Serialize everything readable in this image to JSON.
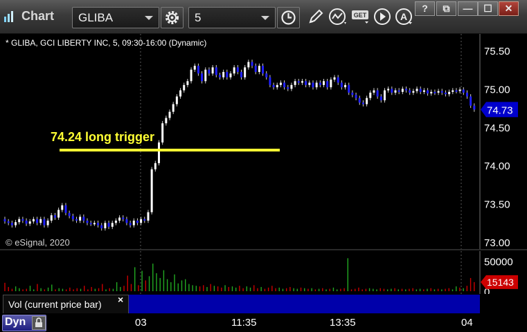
{
  "app": {
    "title": "Chart"
  },
  "toolbar": {
    "symbol": "GLIBA",
    "interval": "5",
    "icons": [
      "gear-icon",
      "clock-icon",
      "pencil-icon",
      "study-icon",
      "get-icon",
      "play-icon",
      "alert-icon"
    ]
  },
  "window_buttons": {
    "help": "?",
    "restore": "⧉",
    "minimize": "—",
    "maximize": "☐",
    "close": "✕"
  },
  "chart": {
    "header": "* GLIBA, GCI LIBERTY INC, 5, 09:30-16:00 (Dynamic)",
    "watermark": "© eSignal, 2020",
    "annotation": "74.24 long trigger",
    "current_price": "74.73",
    "price_ticks": [
      "75.50",
      "75.00",
      "74.50",
      "74.00",
      "73.50",
      "73.00"
    ],
    "colors": {
      "up": "#ffffff",
      "down": "#2020ff",
      "trigger_line": "#ffff33",
      "current_price_bg": "#0000cc"
    }
  },
  "volume": {
    "label": "Vol (current price bar)",
    "close_glyph": "×",
    "ticks": [
      "50000",
      "0"
    ],
    "current_volume": "15143",
    "colors": {
      "up": "#22aa22",
      "down": "#cc0000",
      "current_bg": "#cc0000"
    }
  },
  "time_axis": {
    "dynamic_button": "Dyn",
    "labels": [
      "03",
      "11:35",
      "13:35",
      "04"
    ]
  },
  "chart_data": [
    {
      "type": "line",
      "chart_subtype": "candlestick",
      "title": "* GLIBA, GCI LIBERTY INC, 5, 09:30-16:00 (Dynamic)",
      "ylim": [
        73.0,
        75.5
      ],
      "yticks": [
        73.0,
        73.5,
        74.0,
        74.5,
        75.0,
        75.5
      ],
      "xticks": [
        "03",
        "11:35",
        "13:35",
        "04"
      ],
      "last_price": 74.73,
      "annotation": {
        "text": "74.24 long trigger",
        "level": 74.2
      },
      "series": [
        {
          "name": "GLIBA",
          "values": [
            73.27,
            73.25,
            73.22,
            73.26,
            73.3,
            73.28,
            73.24,
            73.27,
            73.3,
            73.25,
            73.3,
            73.22,
            73.28,
            73.35,
            73.32,
            73.42,
            73.48,
            73.38,
            73.34,
            73.3,
            73.28,
            73.33,
            73.28,
            73.25,
            73.24,
            73.25,
            73.22,
            73.18,
            73.25,
            73.2,
            73.25,
            73.28,
            73.32,
            73.3,
            73.25,
            73.22,
            73.28,
            73.25,
            73.3,
            73.28,
            73.39,
            73.95,
            74.03,
            74.3,
            74.55,
            74.62,
            74.7,
            74.8,
            74.9,
            74.98,
            75.05,
            75.1,
            75.25,
            75.3,
            75.2,
            75.1,
            75.25,
            75.2,
            75.28,
            75.18,
            75.15,
            75.22,
            75.15,
            75.2,
            75.28,
            75.22,
            75.15,
            75.28,
            75.35,
            75.3,
            75.22,
            75.3,
            75.2,
            75.15,
            75.05,
            75.02,
            75.05,
            75.08,
            75.02,
            75.0,
            75.05,
            75.1,
            75.08,
            75.1,
            75.05,
            75.08,
            75.02,
            75.08,
            75.05,
            75.1,
            75.02,
            75.12,
            75.15,
            75.08,
            75.02,
            75.05,
            74.95,
            74.92,
            74.88,
            74.82,
            74.8,
            74.88,
            74.95,
            74.98,
            74.9,
            74.85,
            74.98,
            75.0,
            74.95,
            74.98,
            74.96,
            75.0,
            74.98,
            74.95,
            74.97,
            75.0,
            74.96,
            74.98,
            74.94,
            74.96,
            74.95,
            74.97,
            74.95,
            74.93,
            74.96,
            74.98,
            74.97,
            74.99,
            74.95,
            74.9,
            74.78,
            74.73
          ]
        }
      ]
    },
    {
      "type": "bar",
      "title": "Vol (current price bar)",
      "ylim": [
        0,
        60000
      ],
      "yticks": [
        0,
        50000
      ],
      "last_value": 15143,
      "series": [
        {
          "name": "Vol (current price bar)",
          "values": [
            14000,
            7000,
            4000,
            8000,
            5000,
            3000,
            4000,
            9000,
            3000,
            12000,
            5000,
            3000,
            6000,
            11000,
            3000,
            5000,
            4000,
            3000,
            6000,
            3000,
            5000,
            4000,
            9000,
            3000,
            7000,
            4000,
            5000,
            12000,
            3000,
            5000,
            4000,
            15000,
            7000,
            9000,
            26000,
            12000,
            40000,
            10000,
            34000,
            18000,
            25000,
            46000,
            30000,
            22000,
            35000,
            20000,
            15000,
            28000,
            13000,
            18000,
            20000,
            12000,
            10000,
            9000,
            8000,
            10000,
            7000,
            12000,
            9000,
            8000,
            6000,
            10000,
            7000,
            8000,
            6000,
            9000,
            5000,
            8000,
            6000,
            10000,
            5000,
            7000,
            4000,
            6000,
            9000,
            5000,
            6000,
            4000,
            5000,
            7000,
            5000,
            4000,
            6000,
            5000,
            4000,
            5000,
            3000,
            4000,
            5000,
            3000,
            4000,
            6000,
            3000,
            4000,
            5000,
            55000,
            3000,
            4000,
            6000,
            3000,
            4000,
            5000,
            4000,
            3000,
            5000,
            4000,
            3000,
            4000,
            5000,
            3000,
            4000,
            3000,
            4000,
            5000,
            3000,
            4000,
            3000,
            4000,
            5000,
            3000,
            4000,
            3000,
            4000,
            5000,
            3000,
            8000,
            6000,
            5000,
            9000,
            22000,
            15143
          ]
        }
      ]
    }
  ]
}
